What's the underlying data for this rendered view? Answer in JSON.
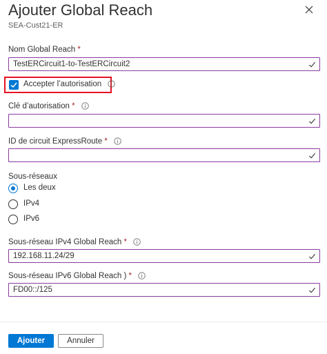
{
  "panel": {
    "title": "Ajouter Global Reach",
    "subtitle": "SEA-Cust21-ER"
  },
  "form": {
    "name_label": "Nom Global Reach",
    "name_value": "TestERCircuit1-to-TestERCircuit2",
    "accept_auth_label": "Accepter l’autorisation",
    "accept_auth_checked": true,
    "auth_key_label": "Clé d’autorisation",
    "auth_key_value": "",
    "circuit_id_label": "ID de circuit ExpressRoute",
    "circuit_id_value": "",
    "subnets_label": "Sous-réseaux",
    "subnet_options": [
      "Les deux",
      "IPv4",
      "IPv6"
    ],
    "subnet_selected": "Les deux",
    "ipv4_label": "Sous-réseau IPv4 Global Reach",
    "ipv4_value": "192.168.11.24/29",
    "ipv6_label": "Sous-réseau IPv6 Global Reach )",
    "ipv6_value": "FD00::/125",
    "required_mark": "*"
  },
  "footer": {
    "add_label": "Ajouter",
    "cancel_label": "Annuler"
  },
  "colors": {
    "accent": "#0078d4",
    "field_border": "#8a3b9e",
    "highlight": "#e81123",
    "required": "#a4262c"
  }
}
